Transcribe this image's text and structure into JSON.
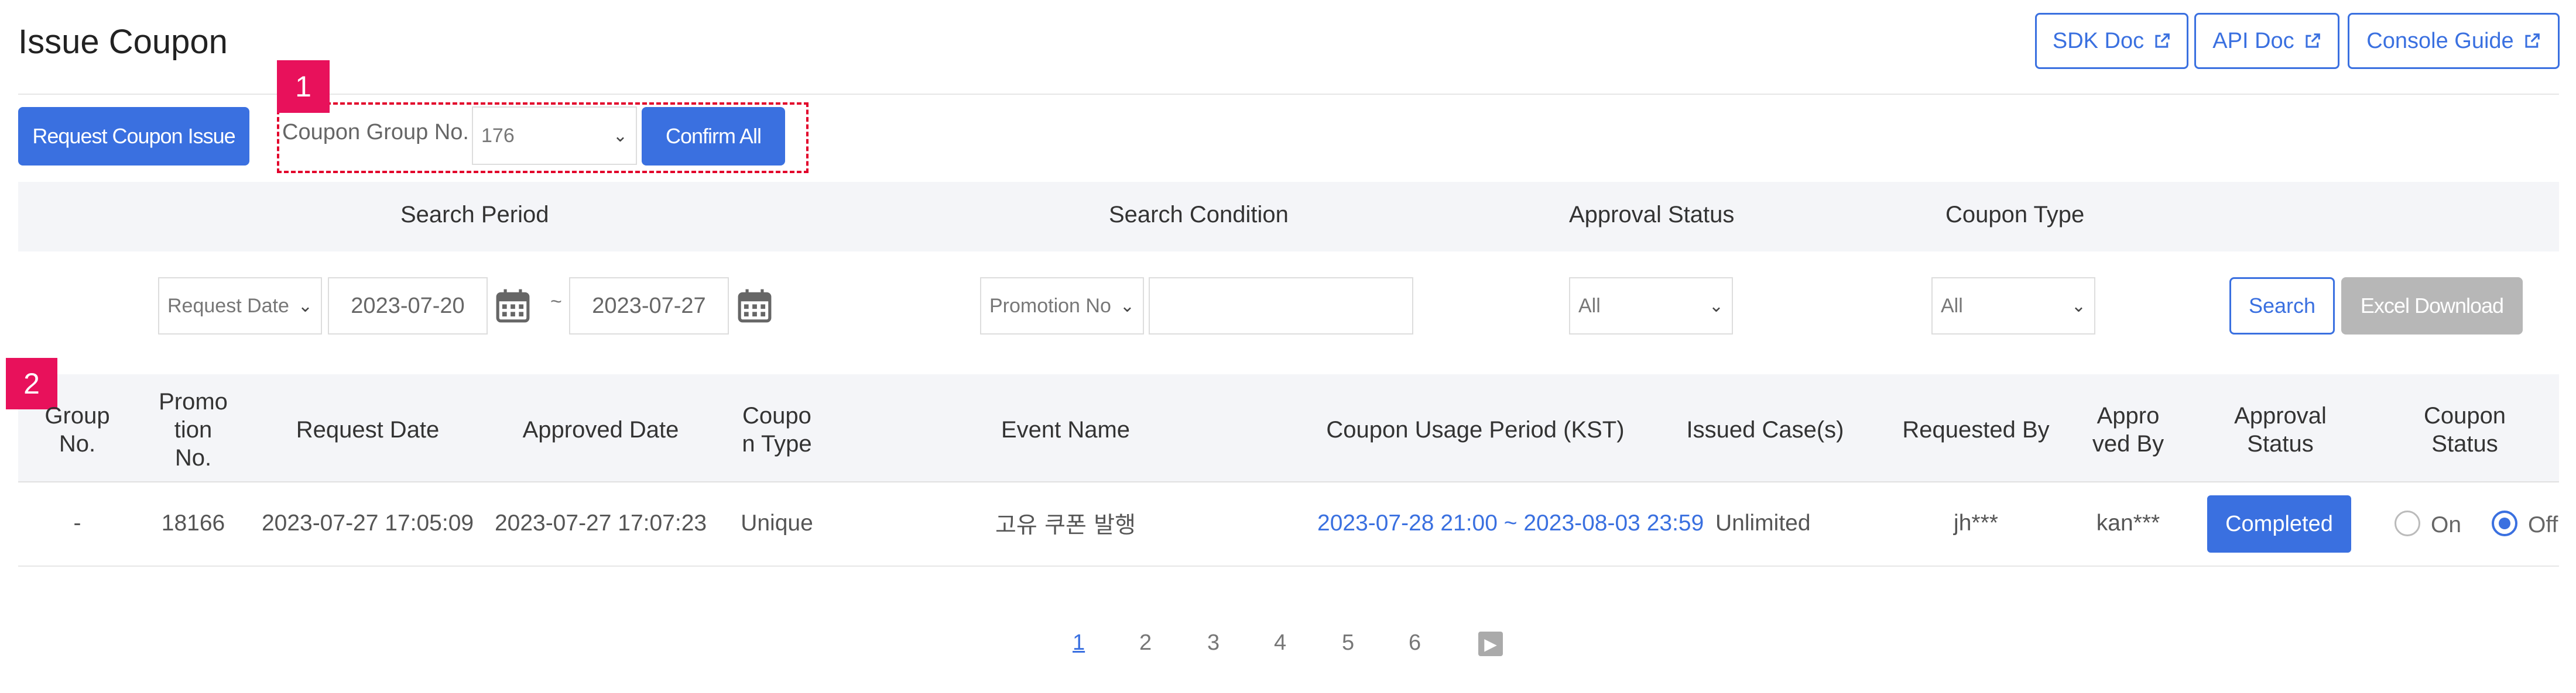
{
  "header": {
    "title": "Issue Coupon"
  },
  "doc_links": [
    "SDK Doc",
    "API Doc",
    "Console Guide"
  ],
  "toolbar": {
    "request_button": "Request Coupon Issue",
    "group_label": "Coupon Group No.",
    "group_value": "176",
    "confirm_all": "Confirm All"
  },
  "annotations": {
    "badge1": "1",
    "badge2": "2"
  },
  "search": {
    "labels": {
      "period": "Search Period",
      "condition": "Search Condition",
      "approval": "Approval Status",
      "type": "Coupon Type"
    },
    "date_type": "Request Date",
    "date_from": "2023-07-20",
    "tilde": "~",
    "date_to": "2023-07-27",
    "condition_field": "Promotion No",
    "condition_value": "",
    "approval_value": "All",
    "type_value": "All",
    "search_button": "Search",
    "excel_button": "Excel Download"
  },
  "table": {
    "headers": [
      "Group\nNo.",
      "Promo\ntion\nNo.",
      "Request Date",
      "Approved Date",
      "Coupo\nn Type",
      "Event Name",
      "Coupon Usage Period (KST)",
      "Issued Case(s)",
      "Requested By",
      "Appro\nved By",
      "Approval\nStatus",
      "Coupon\nStatus"
    ],
    "rows": [
      {
        "group_no": "-",
        "promotion_no": "18166",
        "request_date": "2023-07-27 17:05:09",
        "approved_date": "2023-07-27 17:07:23",
        "coupon_type": "Unique",
        "event_name": "고유 쿠폰 발행",
        "usage_period": "2023-07-28 21:00 ~ 2023-08-03 23:59",
        "issued_cases": "Unlimited",
        "requested_by": "jh***",
        "approved_by": "kan***",
        "approval_status": "Completed",
        "coupon_status_on": "On",
        "coupon_status_off": "Off",
        "coupon_status_selected": "Off"
      }
    ]
  },
  "pagination": {
    "pages": [
      "1",
      "2",
      "3",
      "4",
      "5",
      "6"
    ],
    "current": "1",
    "next_icon": "chevron-right-icon"
  },
  "colors": {
    "accent": "#3a70e0",
    "annotation": "#e8115b",
    "dashed": "#e2002b",
    "disabled": "#b7b7b7",
    "header_bg": "#f4f5f8"
  }
}
